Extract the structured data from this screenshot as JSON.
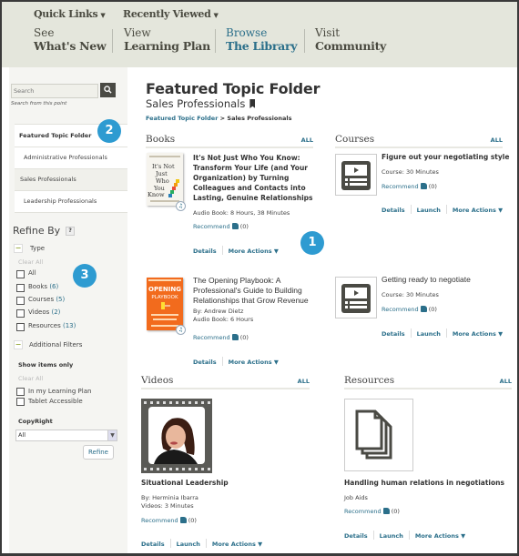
{
  "header": {
    "quick_links": "Quick Links",
    "recently_viewed": "Recently Viewed",
    "nav": [
      {
        "small": "See",
        "big": "What's New"
      },
      {
        "small": "View",
        "big": "Learning Plan"
      },
      {
        "small": "Browse",
        "big": "The Library"
      },
      {
        "small": "Visit",
        "big": "Community"
      }
    ]
  },
  "sidebar": {
    "search_placeholder": "Search",
    "search_hint": "Search from this point",
    "topics": [
      {
        "label": "Featured Topic Folder"
      },
      {
        "label": "Administrative Professionals"
      },
      {
        "label": "Sales Professionals"
      },
      {
        "label": "Leadership Professionals"
      }
    ],
    "refine_by": "Refine By",
    "help": "?",
    "type_label": "Type",
    "clear_all": "Clear All",
    "type_filters": [
      {
        "label": "All",
        "count": ""
      },
      {
        "label": "Books",
        "count": "(6)"
      },
      {
        "label": "Courses",
        "count": "(5)"
      },
      {
        "label": "Videos",
        "count": "(2)"
      },
      {
        "label": "Resources",
        "count": "(13)"
      }
    ],
    "additional_filters": "Additional Filters",
    "show_items_only": "Show items only",
    "show_filters": [
      {
        "label": "In my Learning Plan"
      },
      {
        "label": "Tablet Accessible"
      }
    ],
    "copyright_label": "CopyRight",
    "copyright_value": "All",
    "refine_button": "Refine"
  },
  "badges": [
    "1",
    "2",
    "3"
  ],
  "main": {
    "title": "Featured Topic Folder",
    "subtitle": "Sales Professionals",
    "breadcrumb_link": "Featured Topic Folder",
    "breadcrumb_sep": " > ",
    "breadcrumb_current": "Sales Professionals",
    "all_label": "ALL",
    "recommend": "Recommend",
    "details": "Details",
    "launch": "Launch",
    "more_actions": "More Actions ▼",
    "books": {
      "heading": "Books",
      "items": [
        {
          "title": "It's Not Just Who You Know: Transform Your Life (and Your Organization) by Turning Colleagues and Contacts into Lasting, Genuine Relationships",
          "author": "",
          "meta": "Audio Book: 8 Hours, 38 Minutes",
          "count": "(0)",
          "cover_text": "It's Not Just Who You Know"
        },
        {
          "title": "The Opening Playbook: A Professional's Guide to Building Relationships that Grow Revenue",
          "author": "By: Andrew Dietz",
          "meta": "Audio Book: 6 Hours",
          "count": "(0)",
          "cover_text": "OPENING PLAYBOOK"
        }
      ]
    },
    "courses": {
      "heading": "Courses",
      "items": [
        {
          "title": "Figure out your negotiating style",
          "meta": "Course: 30 Minutes",
          "count": "(0)"
        },
        {
          "title": "Getting ready to negotiate",
          "meta": "Course: 30 Minutes",
          "count": "(0)"
        }
      ]
    },
    "videos": {
      "heading": "Videos",
      "items": [
        {
          "title": "Situational Leadership",
          "author": "By: Herminia Ibarra",
          "meta": "Videos: 3 Minutes",
          "count": "(0)"
        }
      ]
    },
    "resources": {
      "heading": "Resources",
      "items": [
        {
          "title": "Handling human relations in negotiations",
          "meta": "Job Aids",
          "count": "(0)"
        }
      ]
    }
  },
  "colors": {
    "accent": "#2b6f8a",
    "badge": "#2e9bd1",
    "topbar": "#e4e6dc"
  }
}
